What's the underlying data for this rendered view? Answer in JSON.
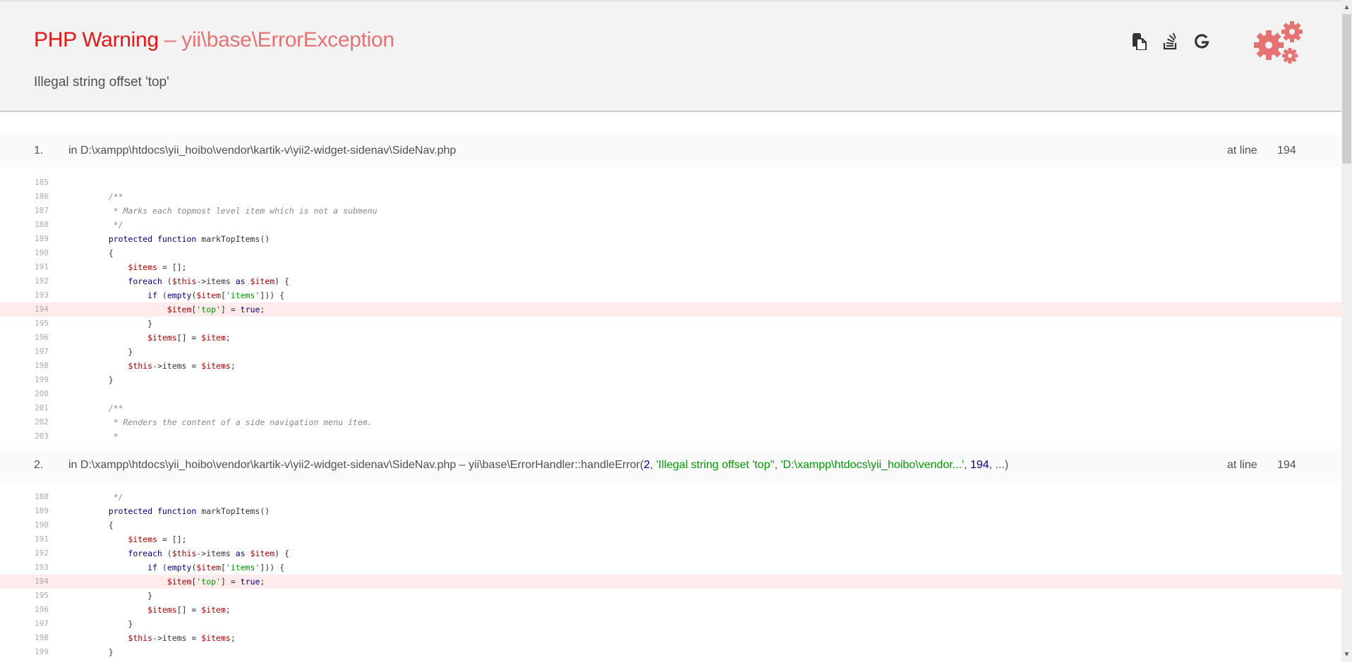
{
  "header": {
    "error_type": "PHP Warning",
    "separator": " – ",
    "exception_class": "yii\\base\\ErrorException",
    "message": "Illegal string offset 'top'",
    "tools": [
      {
        "name": "copy-stacktrace-icon",
        "title": "Copy the stacktrace"
      },
      {
        "name": "stackoverflow-icon",
        "title": "Search error on Stackoverflow"
      },
      {
        "name": "google-icon",
        "title": "Search error on Google"
      }
    ],
    "accent_color": "#e57373"
  },
  "call_stack": [
    {
      "index": "1.",
      "file": "in D:\\xampp\\htdocs\\yii_hoibo\\vendor\\kartik-v\\yii2-widget-sidenav\\SideNav.php",
      "at_line_label": "at line",
      "line": "194",
      "lines": [
        {
          "n": "185",
          "tokens": []
        },
        {
          "n": "186",
          "tokens": [
            {
              "t": "    /**",
              "c": "cm"
            }
          ]
        },
        {
          "n": "187",
          "tokens": [
            {
              "t": "     * Marks each topmost level item which is not a submenu",
              "c": "cm"
            }
          ]
        },
        {
          "n": "188",
          "tokens": [
            {
              "t": "     */",
              "c": "cm"
            }
          ]
        },
        {
          "n": "189",
          "tokens": [
            {
              "t": "    ",
              "c": "pl"
            },
            {
              "t": "protected",
              "c": "kw"
            },
            {
              "t": " ",
              "c": "pl"
            },
            {
              "t": "function",
              "c": "kw"
            },
            {
              "t": " markTopItems()",
              "c": "pl"
            }
          ]
        },
        {
          "n": "190",
          "tokens": [
            {
              "t": "    {",
              "c": "pl"
            }
          ]
        },
        {
          "n": "191",
          "tokens": [
            {
              "t": "        ",
              "c": "pl"
            },
            {
              "t": "$items",
              "c": "var"
            },
            {
              "t": " = [];",
              "c": "pl"
            }
          ]
        },
        {
          "n": "192",
          "tokens": [
            {
              "t": "        ",
              "c": "pl"
            },
            {
              "t": "foreach",
              "c": "kw"
            },
            {
              "t": " (",
              "c": "pl"
            },
            {
              "t": "$this",
              "c": "var"
            },
            {
              "t": "->items ",
              "c": "pl"
            },
            {
              "t": "as",
              "c": "kw"
            },
            {
              "t": " ",
              "c": "pl"
            },
            {
              "t": "$item",
              "c": "var"
            },
            {
              "t": ") {",
              "c": "pl"
            }
          ]
        },
        {
          "n": "193",
          "tokens": [
            {
              "t": "            ",
              "c": "pl"
            },
            {
              "t": "if",
              "c": "kw"
            },
            {
              "t": " (",
              "c": "pl"
            },
            {
              "t": "empty",
              "c": "kw"
            },
            {
              "t": "(",
              "c": "pl"
            },
            {
              "t": "$item",
              "c": "var"
            },
            {
              "t": "[",
              "c": "pl"
            },
            {
              "t": "'items'",
              "c": "str"
            },
            {
              "t": "])) {",
              "c": "pl"
            }
          ]
        },
        {
          "n": "194",
          "err": true,
          "tokens": [
            {
              "t": "                ",
              "c": "pl"
            },
            {
              "t": "$item",
              "c": "var"
            },
            {
              "t": "[",
              "c": "pl"
            },
            {
              "t": "'top'",
              "c": "str"
            },
            {
              "t": "] = ",
              "c": "pl"
            },
            {
              "t": "true",
              "c": "kw"
            },
            {
              "t": ";",
              "c": "pl"
            }
          ]
        },
        {
          "n": "195",
          "tokens": [
            {
              "t": "            }",
              "c": "pl"
            }
          ]
        },
        {
          "n": "196",
          "tokens": [
            {
              "t": "            ",
              "c": "pl"
            },
            {
              "t": "$items",
              "c": "var"
            },
            {
              "t": "[] = ",
              "c": "pl"
            },
            {
              "t": "$item",
              "c": "var"
            },
            {
              "t": ";",
              "c": "pl"
            }
          ]
        },
        {
          "n": "197",
          "tokens": [
            {
              "t": "        }",
              "c": "pl"
            }
          ]
        },
        {
          "n": "198",
          "tokens": [
            {
              "t": "        ",
              "c": "pl"
            },
            {
              "t": "$this",
              "c": "var"
            },
            {
              "t": "->items = ",
              "c": "pl"
            },
            {
              "t": "$items",
              "c": "var"
            },
            {
              "t": ";",
              "c": "pl"
            }
          ]
        },
        {
          "n": "199",
          "tokens": [
            {
              "t": "    }",
              "c": "pl"
            }
          ]
        },
        {
          "n": "200",
          "tokens": []
        },
        {
          "n": "201",
          "tokens": [
            {
              "t": "    /**",
              "c": "cm"
            }
          ]
        },
        {
          "n": "202",
          "tokens": [
            {
              "t": "     * Renders the content of a side navigation menu item.",
              "c": "cm"
            }
          ]
        },
        {
          "n": "203",
          "tokens": [
            {
              "t": "     *",
              "c": "cm"
            }
          ]
        }
      ]
    },
    {
      "index": "2.",
      "file": "in D:\\xampp\\htdocs\\yii_hoibo\\vendor\\kartik-v\\yii2-widget-sidenav\\SideNav.php – yii\\base\\ErrorHandler::handleError(",
      "args": [
        {
          "t": "2",
          "c": "arg-num"
        },
        {
          "t": ", ",
          "c": ""
        },
        {
          "t": "'Illegal string offset 'top''",
          "c": "arg-str"
        },
        {
          "t": ", ",
          "c": ""
        },
        {
          "t": "'D:\\xampp\\htdocs\\yii_hoibo\\vendor...'",
          "c": "arg-str"
        },
        {
          "t": ", ",
          "c": ""
        },
        {
          "t": "194",
          "c": "arg-num"
        },
        {
          "t": ", ...)",
          "c": ""
        }
      ],
      "at_line_label": "at line",
      "line": "194",
      "lines": [
        {
          "n": "188",
          "tokens": [
            {
              "t": "     */",
              "c": "cm"
            }
          ]
        },
        {
          "n": "189",
          "tokens": [
            {
              "t": "    ",
              "c": "pl"
            },
            {
              "t": "protected",
              "c": "kw"
            },
            {
              "t": " ",
              "c": "pl"
            },
            {
              "t": "function",
              "c": "kw"
            },
            {
              "t": " markTopItems()",
              "c": "pl"
            }
          ]
        },
        {
          "n": "190",
          "tokens": [
            {
              "t": "    {",
              "c": "pl"
            }
          ]
        },
        {
          "n": "191",
          "tokens": [
            {
              "t": "        ",
              "c": "pl"
            },
            {
              "t": "$items",
              "c": "var"
            },
            {
              "t": " = [];",
              "c": "pl"
            }
          ]
        },
        {
          "n": "192",
          "tokens": [
            {
              "t": "        ",
              "c": "pl"
            },
            {
              "t": "foreach",
              "c": "kw"
            },
            {
              "t": " (",
              "c": "pl"
            },
            {
              "t": "$this",
              "c": "var"
            },
            {
              "t": "->items ",
              "c": "pl"
            },
            {
              "t": "as",
              "c": "kw"
            },
            {
              "t": " ",
              "c": "pl"
            },
            {
              "t": "$item",
              "c": "var"
            },
            {
              "t": ") {",
              "c": "pl"
            }
          ]
        },
        {
          "n": "193",
          "tokens": [
            {
              "t": "            ",
              "c": "pl"
            },
            {
              "t": "if",
              "c": "kw"
            },
            {
              "t": " (",
              "c": "pl"
            },
            {
              "t": "empty",
              "c": "kw"
            },
            {
              "t": "(",
              "c": "pl"
            },
            {
              "t": "$item",
              "c": "var"
            },
            {
              "t": "[",
              "c": "pl"
            },
            {
              "t": "'items'",
              "c": "str"
            },
            {
              "t": "])) {",
              "c": "pl"
            }
          ]
        },
        {
          "n": "194",
          "err": true,
          "tokens": [
            {
              "t": "                ",
              "c": "pl"
            },
            {
              "t": "$item",
              "c": "var"
            },
            {
              "t": "[",
              "c": "pl"
            },
            {
              "t": "'top'",
              "c": "str"
            },
            {
              "t": "] = ",
              "c": "pl"
            },
            {
              "t": "true",
              "c": "kw"
            },
            {
              "t": ";",
              "c": "pl"
            }
          ]
        },
        {
          "n": "195",
          "tokens": [
            {
              "t": "            }",
              "c": "pl"
            }
          ]
        },
        {
          "n": "196",
          "tokens": [
            {
              "t": "            ",
              "c": "pl"
            },
            {
              "t": "$items",
              "c": "var"
            },
            {
              "t": "[] = ",
              "c": "pl"
            },
            {
              "t": "$item",
              "c": "var"
            },
            {
              "t": ";",
              "c": "pl"
            }
          ]
        },
        {
          "n": "197",
          "tokens": [
            {
              "t": "        }",
              "c": "pl"
            }
          ]
        },
        {
          "n": "198",
          "tokens": [
            {
              "t": "        ",
              "c": "pl"
            },
            {
              "t": "$this",
              "c": "var"
            },
            {
              "t": "->items = ",
              "c": "pl"
            },
            {
              "t": "$items",
              "c": "var"
            },
            {
              "t": ";",
              "c": "pl"
            }
          ]
        },
        {
          "n": "199",
          "tokens": [
            {
              "t": "    }",
              "c": "pl"
            }
          ]
        }
      ]
    }
  ]
}
